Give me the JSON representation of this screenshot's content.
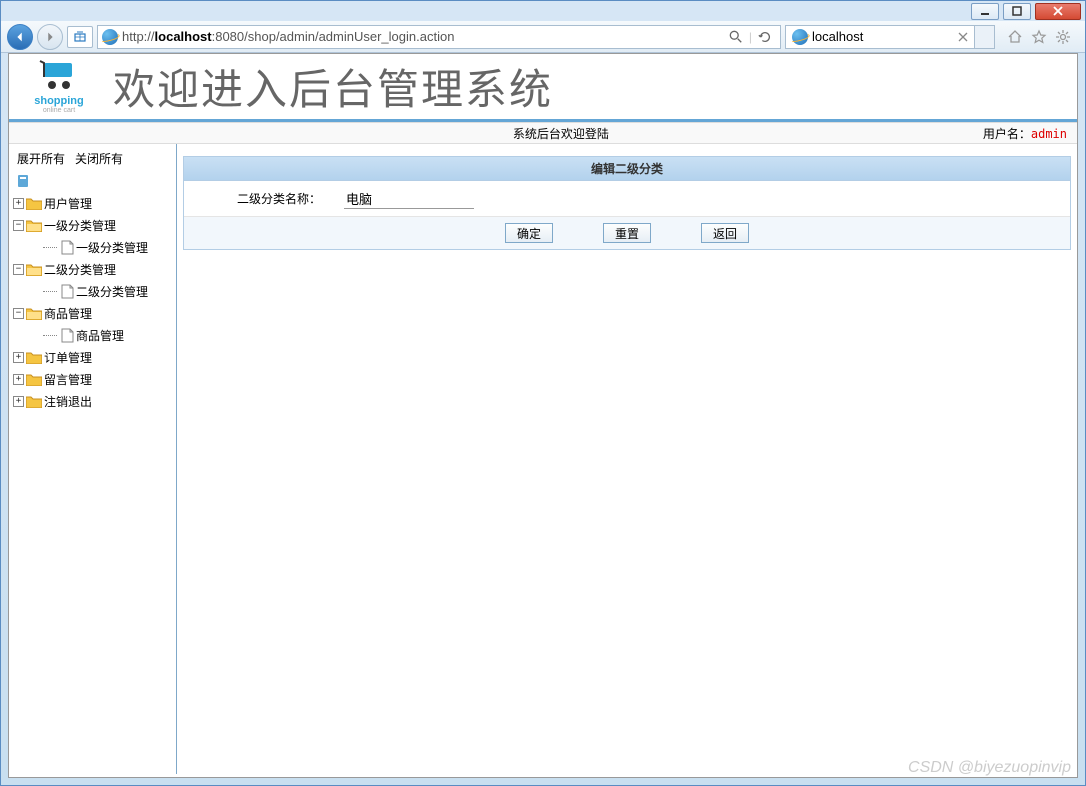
{
  "browser": {
    "url_prefix": "http://",
    "url_host": "localhost",
    "url_rest": ":8080/shop/admin/adminUser_login.action",
    "tab_title": "localhost"
  },
  "banner": {
    "logo_text": "shopping",
    "logo_sub": "online cart",
    "title": "欢迎进入后台管理系统"
  },
  "status": {
    "center": "系统后台欢迎登陆",
    "user_label": "用户名：",
    "username": "admin"
  },
  "sidebar": {
    "expand_all": "展开所有",
    "collapse_all": "关闭所有",
    "items": {
      "user_mgmt": "用户管理",
      "cat1_mgmt": "一级分类管理",
      "cat1_sub": "一级分类管理",
      "cat2_mgmt": "二级分类管理",
      "cat2_sub": "二级分类管理",
      "product_mgmt": "商品管理",
      "product_sub": "商品管理",
      "order_mgmt": "订单管理",
      "message_mgmt": "留言管理",
      "logout": "注销退出"
    }
  },
  "panel": {
    "title": "编辑二级分类",
    "field_label": "二级分类名称：",
    "field_value": "电脑",
    "btn_ok": "确定",
    "btn_reset": "重置",
    "btn_back": "返回"
  },
  "watermark": "CSDN @biyezuopinvip"
}
